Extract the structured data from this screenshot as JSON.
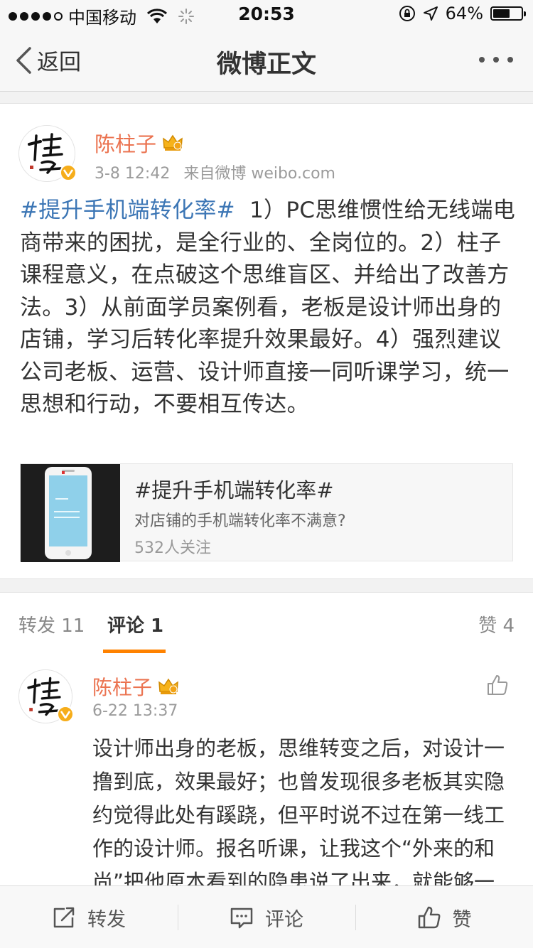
{
  "status_bar": {
    "carrier": "中国移动",
    "time": "20:53",
    "battery": "64%",
    "battery_level": 0.64
  },
  "nav": {
    "back_label": "返回",
    "title": "微博正文"
  },
  "post": {
    "author": "陈柱子",
    "time": "3-8 12:42",
    "source": "来自微博 weibo.com",
    "hashtag": "#提升手机端转化率#",
    "body": "1）PC思维惯性给无线端电商带来的困扰，是全行业的、全岗位的。2）柱子课程意义，在点破这个思维盲区、并给出了改善方法。3）从前面学员案例看，老板是设计师出身的店铺，学习后转化率提升效果最好。4）强烈建议公司老板、运营、设计师直接一同听课学习，统一思想和行动，不要相互传达。",
    "topic_card": {
      "title": "#提升手机端转化率#",
      "description": "对店铺的手机端转化率不满意?",
      "followers": "532人关注"
    }
  },
  "tabs": {
    "repost": "转发 11",
    "comment": "评论 1",
    "like": "赞 4"
  },
  "comment": {
    "author": "陈柱子",
    "time": "6-22 13:37",
    "text": "设计师出身的老板，思维转变之后，对设计一撸到底，效果最好；也曾发现很多老板其实隐约觉得此处有蹊跷，但平时说不过在第一线工作的设计师。报名听课，让我这个“外来的和尚”把他原本看到的隐患说了出来，就能够一下子达成共识，再谈过程与行为"
  },
  "toolbar": {
    "repost": "转发",
    "comment": "评论",
    "like": "赞"
  },
  "colors": {
    "username": "#eb7350",
    "hashtag": "#3c76b5",
    "tab_accent": "#ff8200",
    "verified_badge": "#f6ad1a"
  }
}
